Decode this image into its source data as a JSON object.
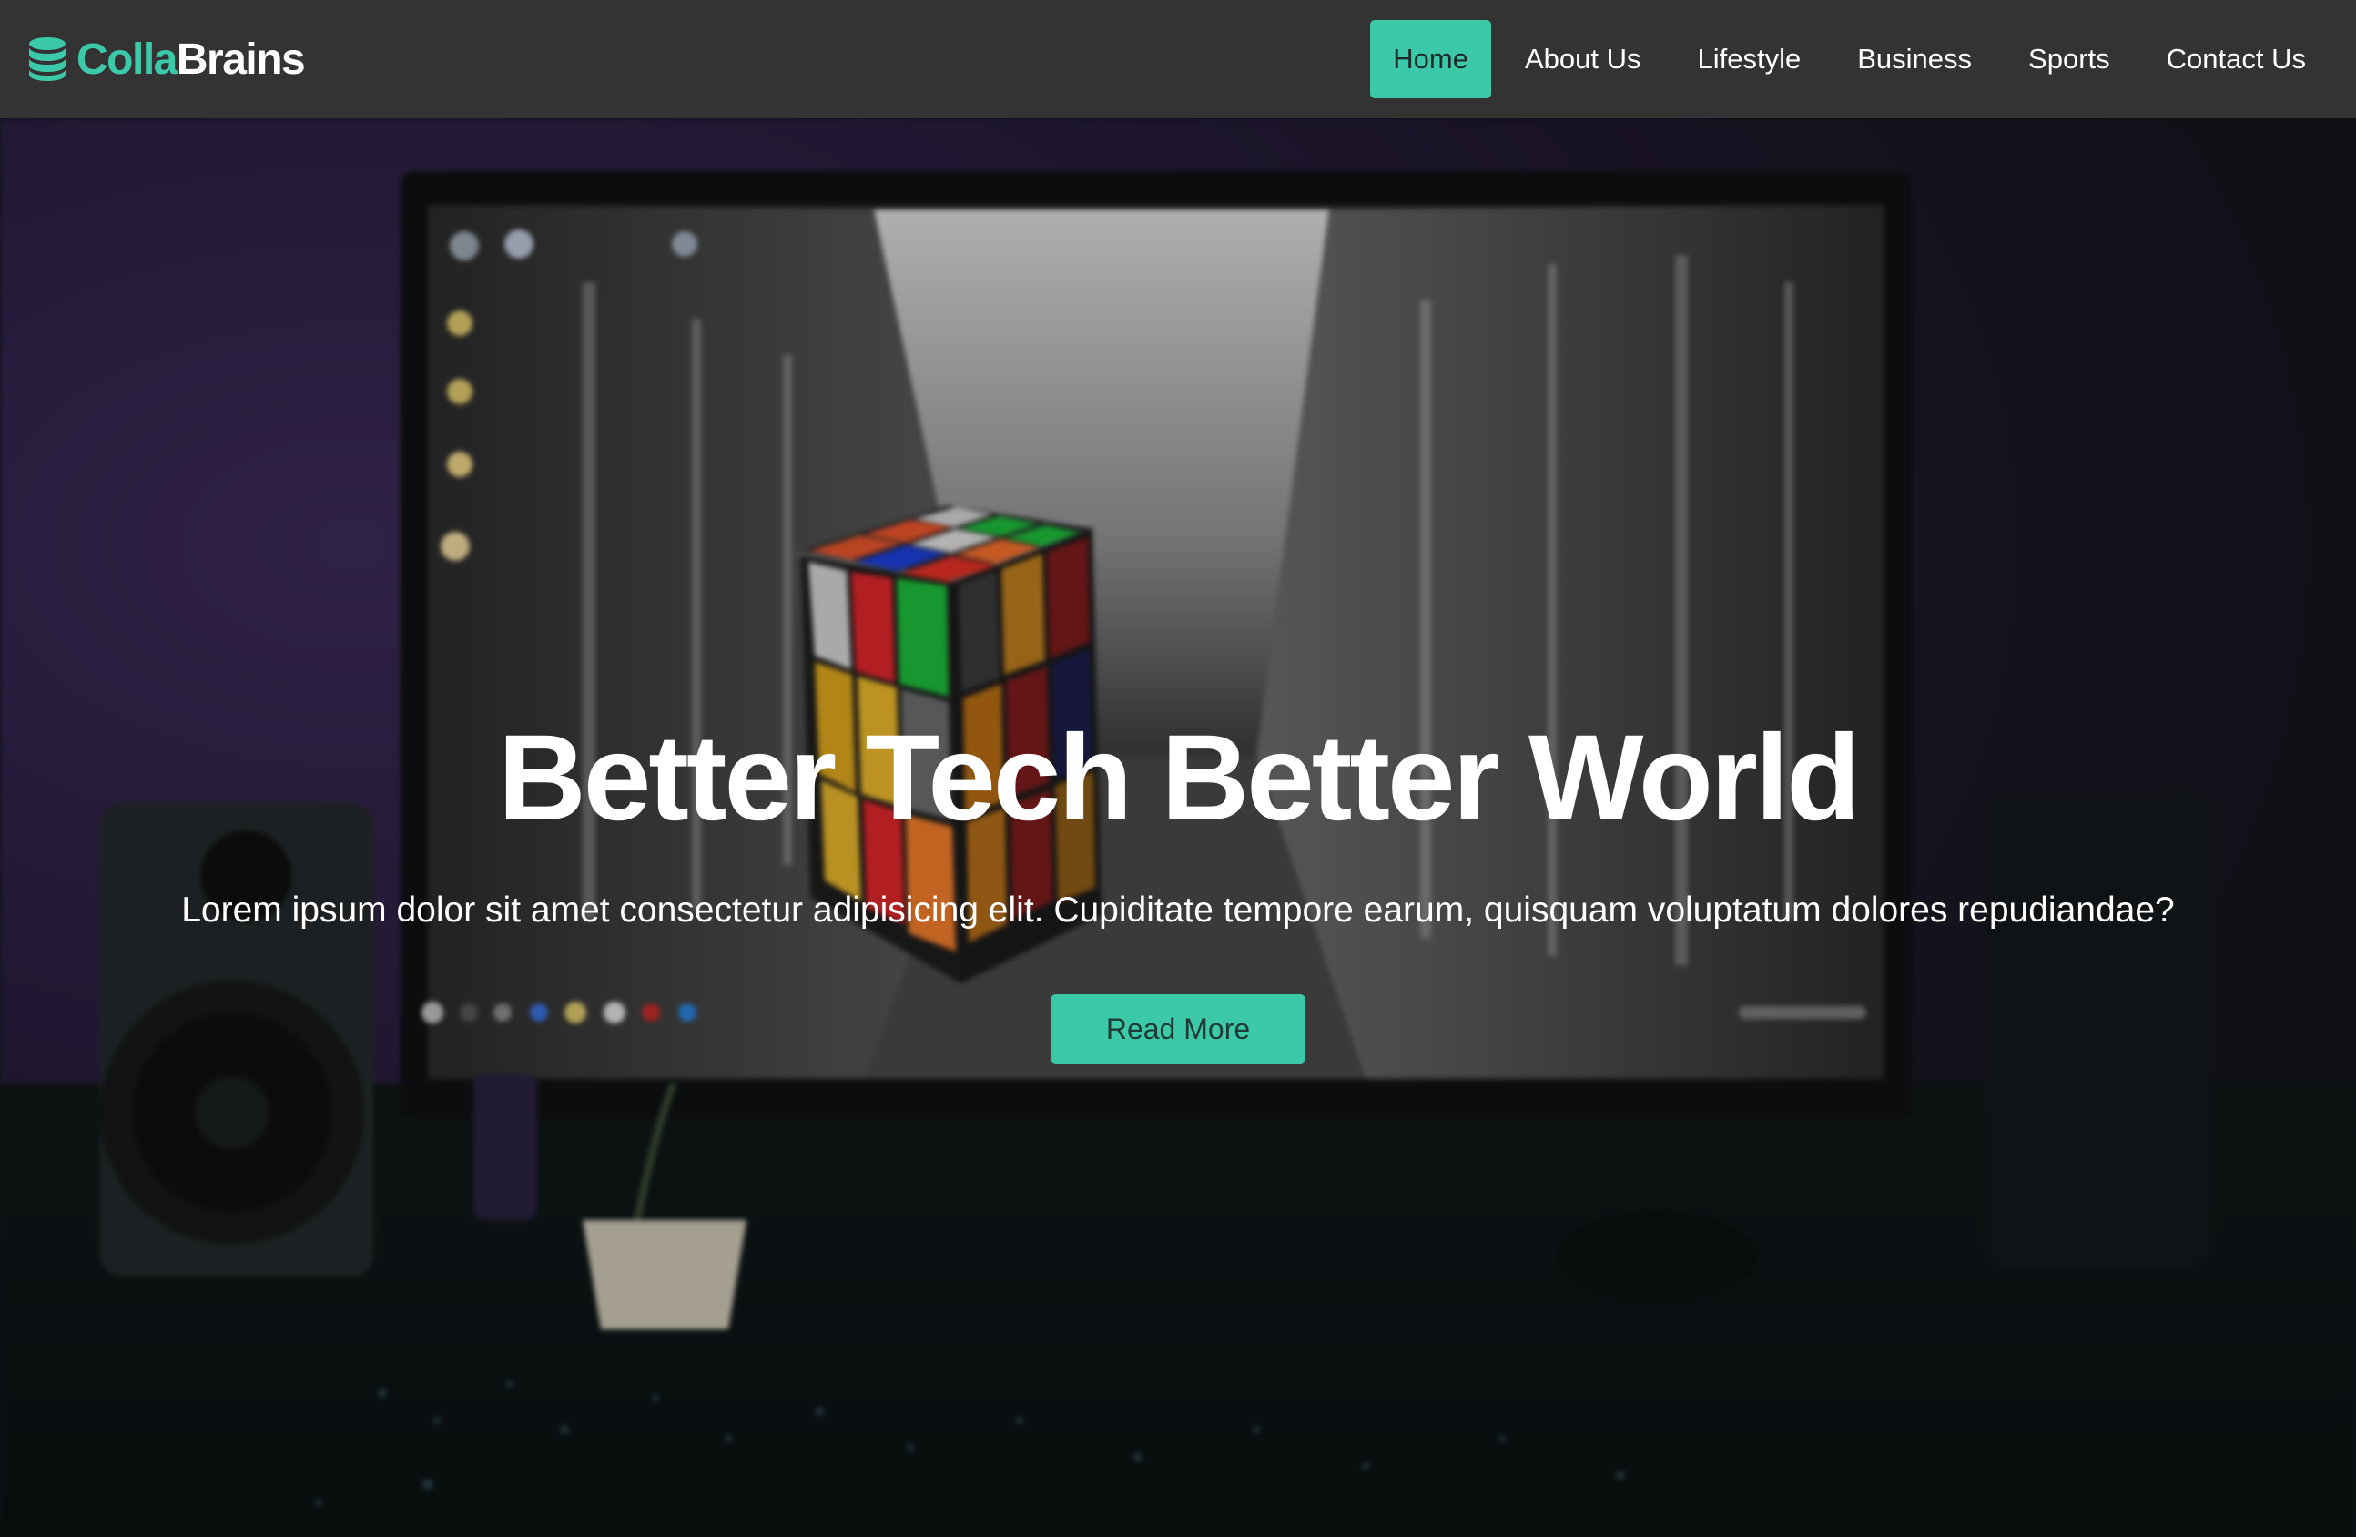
{
  "brand": {
    "part1": "Colla",
    "part2": "Brains",
    "icon": "database-icon"
  },
  "nav": {
    "items": [
      {
        "label": "Home",
        "active": true
      },
      {
        "label": "About Us",
        "active": false
      },
      {
        "label": "Lifestyle",
        "active": false
      },
      {
        "label": "Business",
        "active": false
      },
      {
        "label": "Sports",
        "active": false
      },
      {
        "label": "Contact Us",
        "active": false
      }
    ]
  },
  "hero": {
    "title": "Better Tech Better World",
    "subtitle": "Lorem ipsum dolor sit amet consectetur adipisicing elit. Cupiditate tempore earum, quisquam voluptatum dolores repudiandae?",
    "button_label": "Read More"
  },
  "colors": {
    "accent": "#3cc9aa",
    "navbar_bg": "#333333",
    "text": "#ffffff"
  }
}
